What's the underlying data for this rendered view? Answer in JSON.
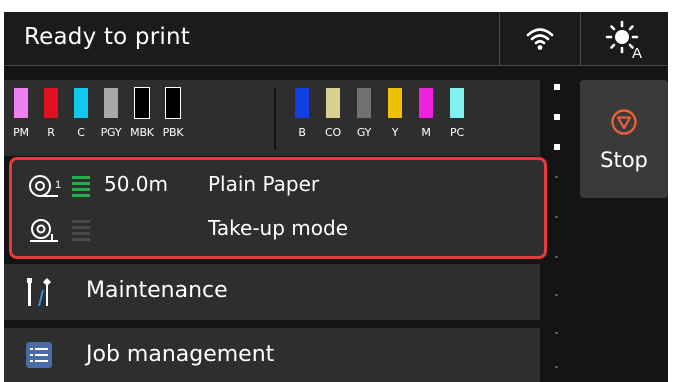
{
  "header": {
    "status": "Ready to print",
    "wifi_icon": "wifi-icon",
    "brightness_icon": "brightness-auto-icon"
  },
  "inks": [
    {
      "label": "PM",
      "color": "#f07ff0"
    },
    {
      "label": "R",
      "color": "#e01020"
    },
    {
      "label": "C",
      "color": "#10c8f0"
    },
    {
      "label": "PGY",
      "color": "#a8a8a8"
    },
    {
      "label": "MBK",
      "color": "#000000"
    },
    {
      "label": "PBK",
      "color": "#000000"
    },
    {
      "label": "B",
      "color": "#1040e0"
    },
    {
      "label": "CO",
      "color": "#d8d090"
    },
    {
      "label": "GY",
      "color": "#707070"
    },
    {
      "label": "Y",
      "color": "#f0c000"
    },
    {
      "label": "M",
      "color": "#f020e0"
    },
    {
      "label": "PC",
      "color": "#80f0f0"
    }
  ],
  "paper": {
    "roll1": {
      "icon": "roll-1-icon",
      "level_bars_lit": 4,
      "length": "50.0m",
      "type": "Plain Paper"
    },
    "roll2": {
      "icon": "take-up-roll-icon",
      "level_bars_lit": 0,
      "mode": "Take-up mode"
    },
    "highlight_color": "#e8393b",
    "level_color": "#22b04a"
  },
  "menu": [
    {
      "icon": "maintenance-icon",
      "label": "Maintenance"
    },
    {
      "icon": "job-list-icon",
      "label": "Job management"
    }
  ],
  "stop": {
    "icon": "stop-icon",
    "label": "Stop",
    "color": "#e8603a"
  }
}
